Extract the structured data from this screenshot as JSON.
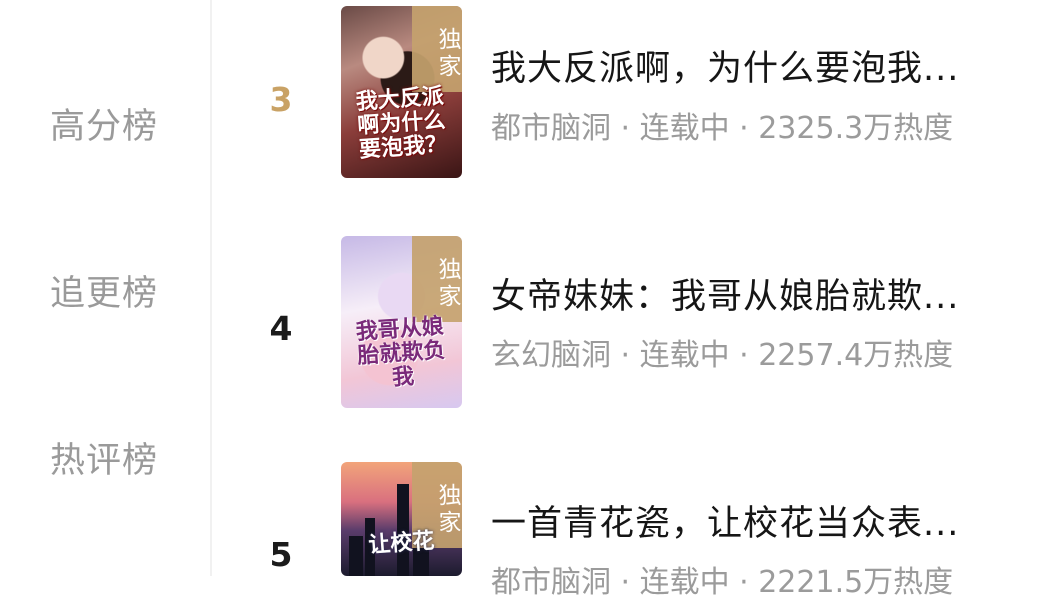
{
  "sidebar": {
    "items": [
      {
        "label": "高分榜"
      },
      {
        "label": "追更榜"
      },
      {
        "label": "热评榜"
      }
    ]
  },
  "books": [
    {
      "rank": "3",
      "badge": "独家",
      "title": "我大反派啊，为什么要泡我...",
      "meta": "都市脑洞 · 连载中 · 2325.3万热度",
      "cover_text": "我大反派啊为什么要泡我？"
    },
    {
      "rank": "4",
      "badge": "独家",
      "title": "女帝妹妹：我哥从娘胎就欺...",
      "meta": "玄幻脑洞 · 连载中 · 2257.4万热度",
      "cover_text": "我哥从娘胎就欺负我"
    },
    {
      "rank": "5",
      "badge": "独家",
      "title": "一首青花瓷，让校花当众表...",
      "meta": "都市脑洞 · 连载中 · 2221.5万热度",
      "cover_text": "让校花"
    }
  ],
  "colors": {
    "rank_top": "#c9a265",
    "rank_default": "#1b1b1b",
    "badge_bg": "#c4a26e",
    "meta_text": "#9b9b9b",
    "sidebar_text": "#9a9a9a"
  }
}
